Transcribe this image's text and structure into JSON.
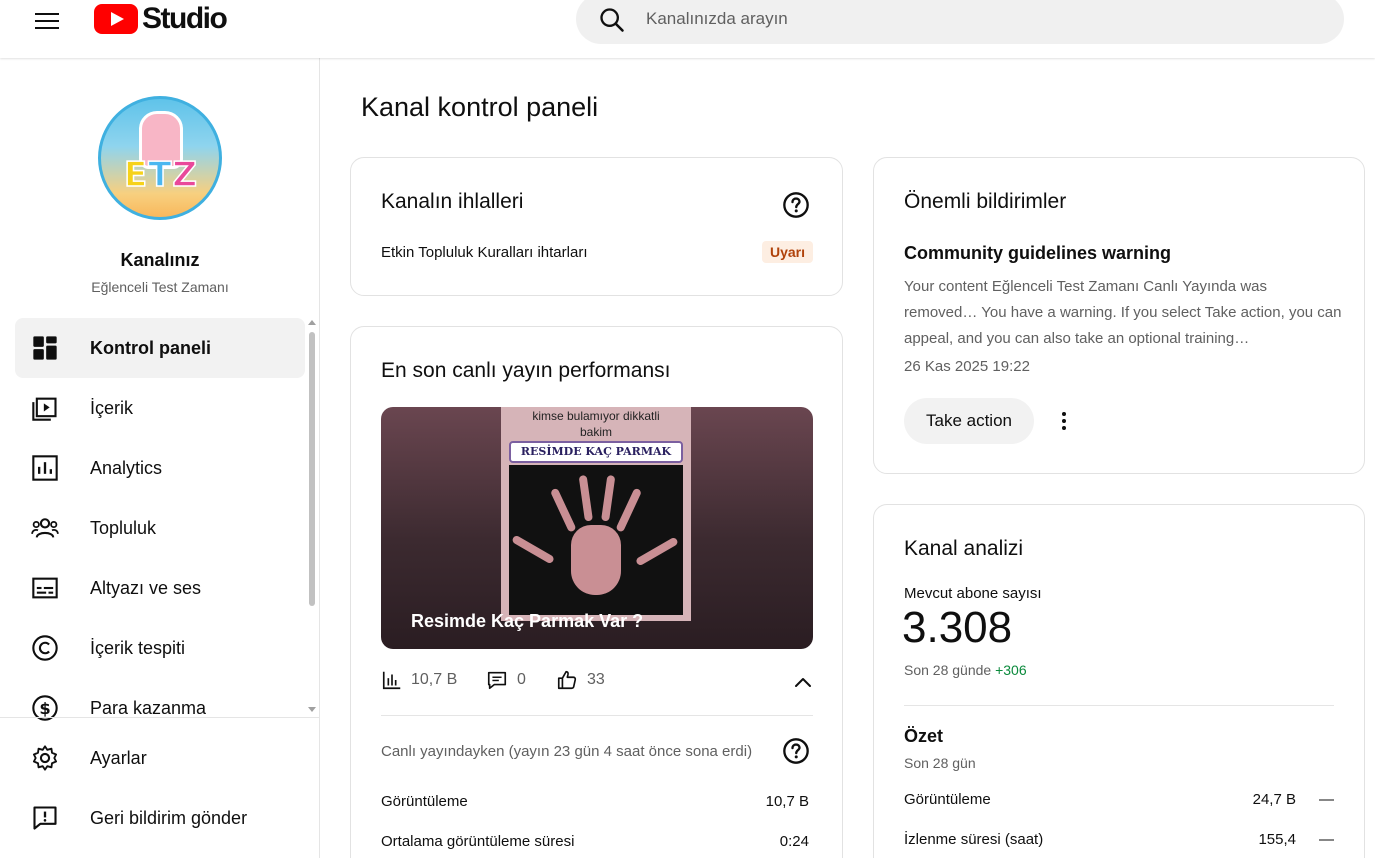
{
  "header": {
    "logo_text": "Studio",
    "search_placeholder": "Kanalınızda arayın"
  },
  "sidebar": {
    "channel_title": "Kanalınız",
    "channel_name": "Eğlenceli Test Zamanı",
    "avatar_text": "ETZ",
    "items": [
      {
        "label": "Kontrol paneli",
        "icon": "dashboard-icon",
        "active": true
      },
      {
        "label": "İçerik",
        "icon": "content-icon"
      },
      {
        "label": "Analytics",
        "icon": "analytics-icon"
      },
      {
        "label": "Topluluk",
        "icon": "community-icon"
      },
      {
        "label": "Altyazı ve ses",
        "icon": "subtitles-icon"
      },
      {
        "label": "İçerik tespiti",
        "icon": "copyright-icon"
      },
      {
        "label": "Para kazanma",
        "icon": "monetization-icon"
      }
    ],
    "bottom_items": [
      {
        "label": "Ayarlar",
        "icon": "settings-icon"
      },
      {
        "label": "Geri bildirim gönder",
        "icon": "feedback-icon"
      }
    ]
  },
  "main": {
    "page_title": "Kanal kontrol paneli",
    "violations": {
      "title": "Kanalın ihlalleri",
      "strike_text": "Etkin Topluluk Kuralları ihtarları",
      "badge": "Uyarı"
    },
    "latest_live": {
      "title": "En son canlı yayın performansı",
      "thumbnail_text_line1": "kimse bulamıyor dikkatli",
      "thumbnail_text_line2": "bakim",
      "thumbnail_banner": "RESİMDE KAÇ PARMAK VAR?",
      "video_title": "Resimde Kaç Parmak Var ?",
      "views": "10,7 B",
      "comments": "0",
      "likes": "33",
      "live_caption": "Canlı yayındayken (yayın 23 gün 4 saat önce sona erdi)",
      "metrics": [
        {
          "label": "Görüntüleme",
          "value": "10,7 B"
        },
        {
          "label": "Ortalama görüntüleme süresi",
          "value": "0:24"
        }
      ]
    },
    "notifications": {
      "title": "Önemli bildirimler",
      "item_title": "Community guidelines warning",
      "item_body": "Your content Eğlenceli Test Zamanı Canlı Yayında was removed… You have a warning. If you select Take action, you can appeal, and you can also take an optional training…",
      "item_date": "26 Kas 2025 19:22",
      "action_label": "Take action"
    },
    "analytics": {
      "title": "Kanal analizi",
      "subs_label": "Mevcut abone sayısı",
      "subs_count": "3.308",
      "subs_period": "Son 28 günde",
      "subs_change": "+306",
      "summary_title": "Özet",
      "summary_period": "Son 28 gün",
      "rows": [
        {
          "label": "Görüntüleme",
          "value": "24,7 B",
          "delta": "—"
        },
        {
          "label": "İzlenme süresi (saat)",
          "value": "155,4",
          "delta": "—"
        }
      ]
    }
  },
  "colors": {
    "brand_red": "#ff0000",
    "positive_green": "#0b8a3c",
    "warning_badge_bg": "#fdeee2",
    "warning_badge_text": "#b0420a"
  }
}
